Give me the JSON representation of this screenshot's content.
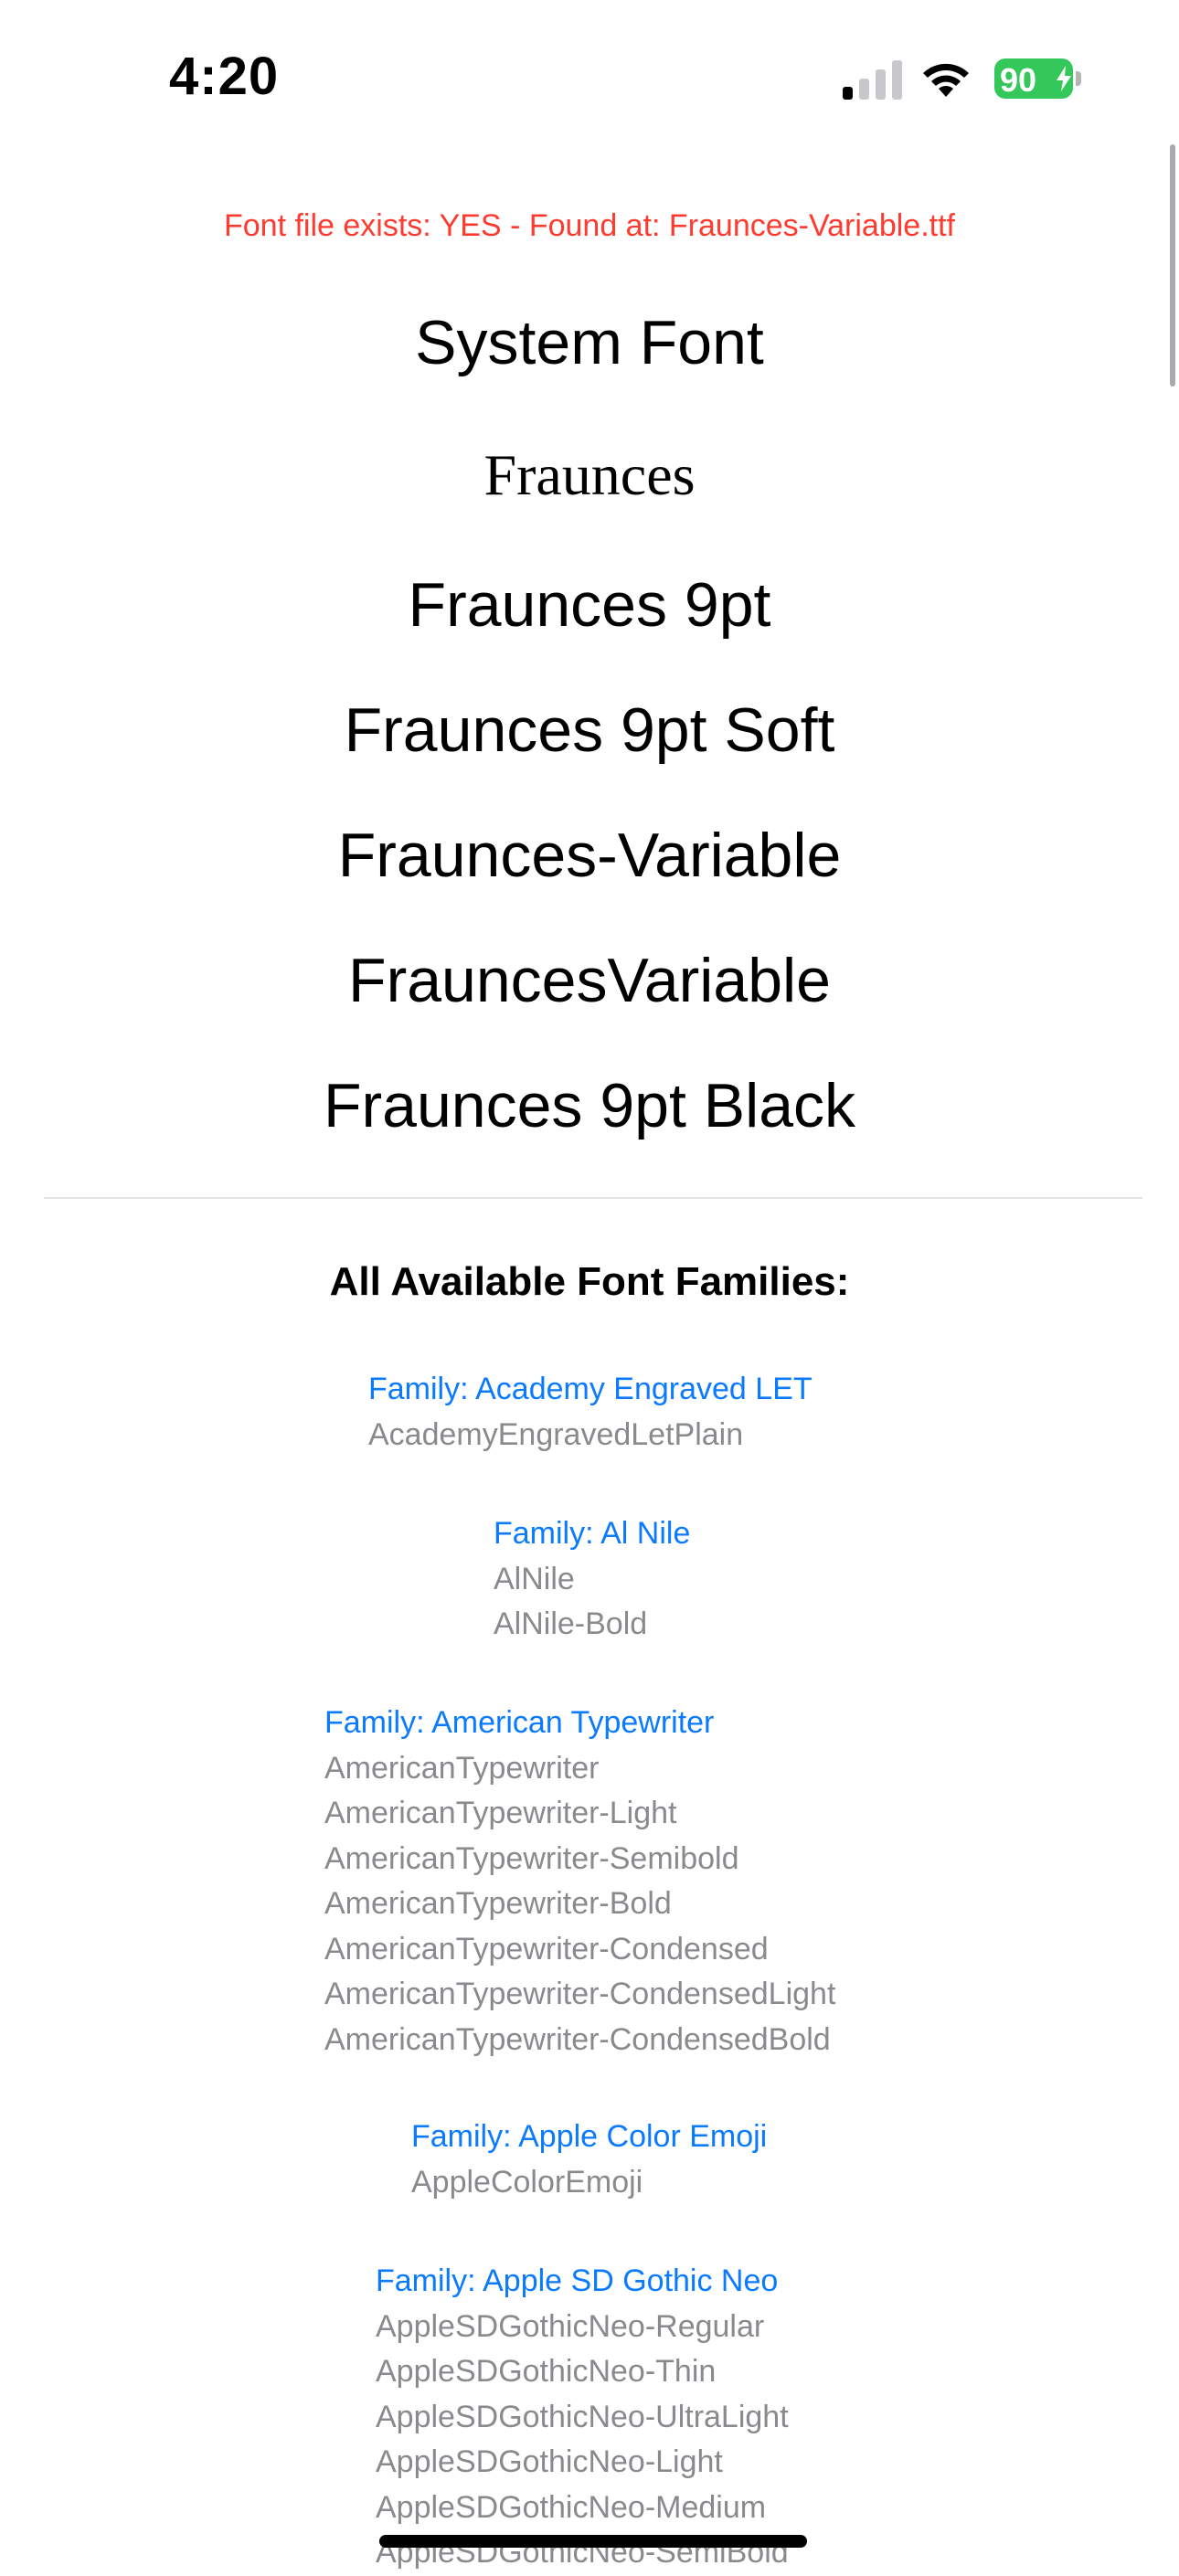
{
  "status_bar": {
    "time": "4:20",
    "battery_percent": "90",
    "battery_color": "#34c759",
    "icons": [
      "cellular-signal-icon",
      "wifi-icon",
      "battery-icon",
      "charging-bolt-icon"
    ]
  },
  "notice": {
    "text": "Font file exists: YES - Found at: Fraunces-Variable.ttf",
    "color": "#ff3b30"
  },
  "font_samples": [
    "System Font",
    "Fraunces",
    "Fraunces 9pt",
    "Fraunces 9pt Soft",
    "Fraunces-Variable",
    "FrauncesVariable",
    "Fraunces 9pt Black"
  ],
  "families_heading": "All Available Font Families:",
  "families": [
    {
      "title": "Family: Academy Engraved LET",
      "fonts": [
        "AcademyEngravedLetPlain"
      ]
    },
    {
      "title": "Family: Al Nile",
      "fonts": [
        "AlNile",
        "AlNile-Bold"
      ]
    },
    {
      "title": "Family: American Typewriter",
      "fonts": [
        "AmericanTypewriter",
        "AmericanTypewriter-Light",
        "AmericanTypewriter-Semibold",
        "AmericanTypewriter-Bold",
        "AmericanTypewriter-Condensed",
        "AmericanTypewriter-CondensedLight",
        "AmericanTypewriter-CondensedBold"
      ]
    },
    {
      "title": "Family: Apple Color Emoji",
      "fonts": [
        "AppleColorEmoji"
      ]
    },
    {
      "title": "Family: Apple SD Gothic Neo",
      "fonts": [
        "AppleSDGothicNeo-Regular",
        "AppleSDGothicNeo-Thin",
        "AppleSDGothicNeo-UltraLight",
        "AppleSDGothicNeo-Light",
        "AppleSDGothicNeo-Medium",
        "AppleSDGothicNeo-SemiBold"
      ]
    }
  ],
  "colors": {
    "family_title": "#0a7aff",
    "font_name": "#8a8a8e"
  }
}
